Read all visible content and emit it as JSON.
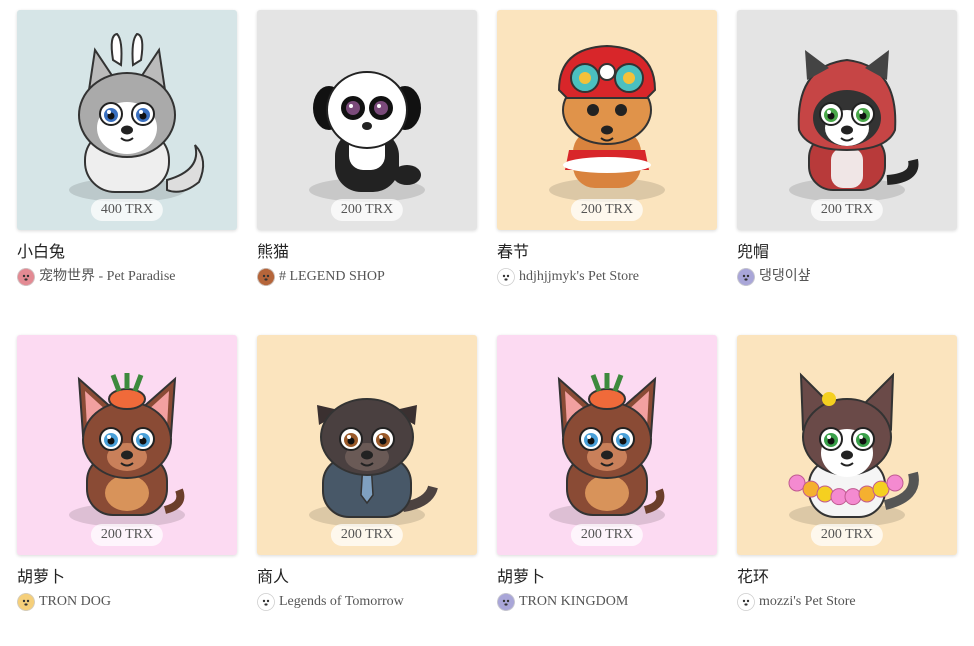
{
  "pets": [
    {
      "name": "小白兔",
      "price": "400 TRX",
      "seller": "宠物世界 - Pet Paradise",
      "bg": "#d6e5e7",
      "avatar_color": "#e38a93",
      "kind": "husky-bunny"
    },
    {
      "name": "熊猫",
      "price": "200 TRX",
      "seller": "# LEGEND SHOP",
      "bg": "#e4e4e4",
      "avatar_color": "#b5653a",
      "kind": "panda"
    },
    {
      "name": "春节",
      "price": "200 TRX",
      "seller": "hdjhjjmyk's Pet Store",
      "bg": "#fbe4be",
      "avatar_color": "#ffffff",
      "kind": "lion-dance"
    },
    {
      "name": "兜帽",
      "price": "200 TRX",
      "seller": "댕댕이샾",
      "bg": "#e4e4e4",
      "avatar_color": "#a9a6d8",
      "kind": "hood"
    },
    {
      "name": "胡萝卜",
      "price": "200 TRX",
      "seller": "TRON DOG",
      "bg": "#fcdaf2",
      "avatar_color": "#f5cf7a",
      "kind": "carrot"
    },
    {
      "name": "商人",
      "price": "200 TRX",
      "seller": "Legends of Tomorrow",
      "bg": "#fbe4be",
      "avatar_color": "#ffffff",
      "kind": "pug"
    },
    {
      "name": "胡萝卜",
      "price": "200 TRX",
      "seller": "TRON KINGDOM",
      "bg": "#fcdaf2",
      "avatar_color": "#a9a6d8",
      "kind": "carrot"
    },
    {
      "name": "花环",
      "price": "200 TRX",
      "seller": "mozzi's Pet Store",
      "bg": "#fbe4be",
      "avatar_color": "#ffffff",
      "kind": "lei"
    }
  ]
}
